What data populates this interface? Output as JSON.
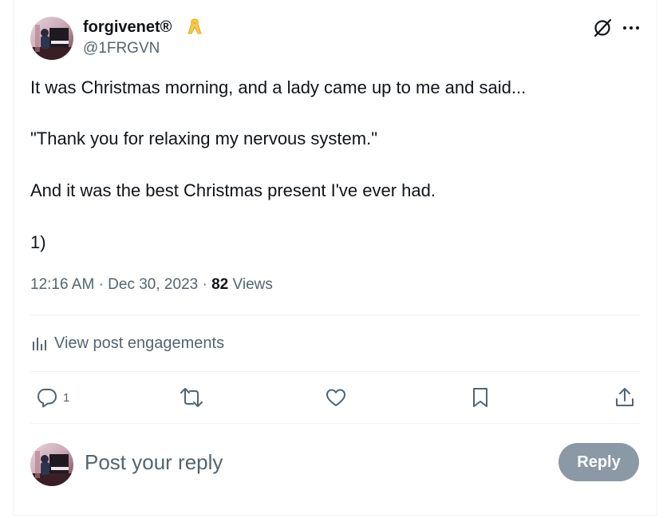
{
  "author": {
    "display_name": "forgivenet®",
    "handle": "@1FRGVN",
    "badge_icon": "awareness-ribbon-icon",
    "badge_color": "#f7c948"
  },
  "header_actions": {
    "grok_icon": "grok-icon",
    "more_icon": "more-icon"
  },
  "tweet": {
    "lines": [
      "It was Christmas morning, and a lady came up to me and said...",
      "\"Thank you for relaxing my nervous system.\"",
      "And it was the best Christmas present I've ever had.",
      "1)"
    ]
  },
  "meta": {
    "time": "12:16 AM",
    "separator": "·",
    "date": "Dec 30, 2023",
    "views_count": "82",
    "views_label": "Views"
  },
  "engagements": {
    "label": "View post engagements",
    "icon": "analytics-icon"
  },
  "actions": {
    "reply_count": "1",
    "reply_icon": "reply-icon",
    "repost_icon": "repost-icon",
    "like_icon": "heart-icon",
    "bookmark_icon": "bookmark-icon",
    "share_icon": "share-icon"
  },
  "composer": {
    "placeholder": "Post your reply",
    "button_label": "Reply"
  },
  "colors": {
    "text_primary": "#0f1419",
    "text_secondary": "#536471",
    "divider": "#eff3f4",
    "reply_button_disabled": "#8b98a5"
  }
}
